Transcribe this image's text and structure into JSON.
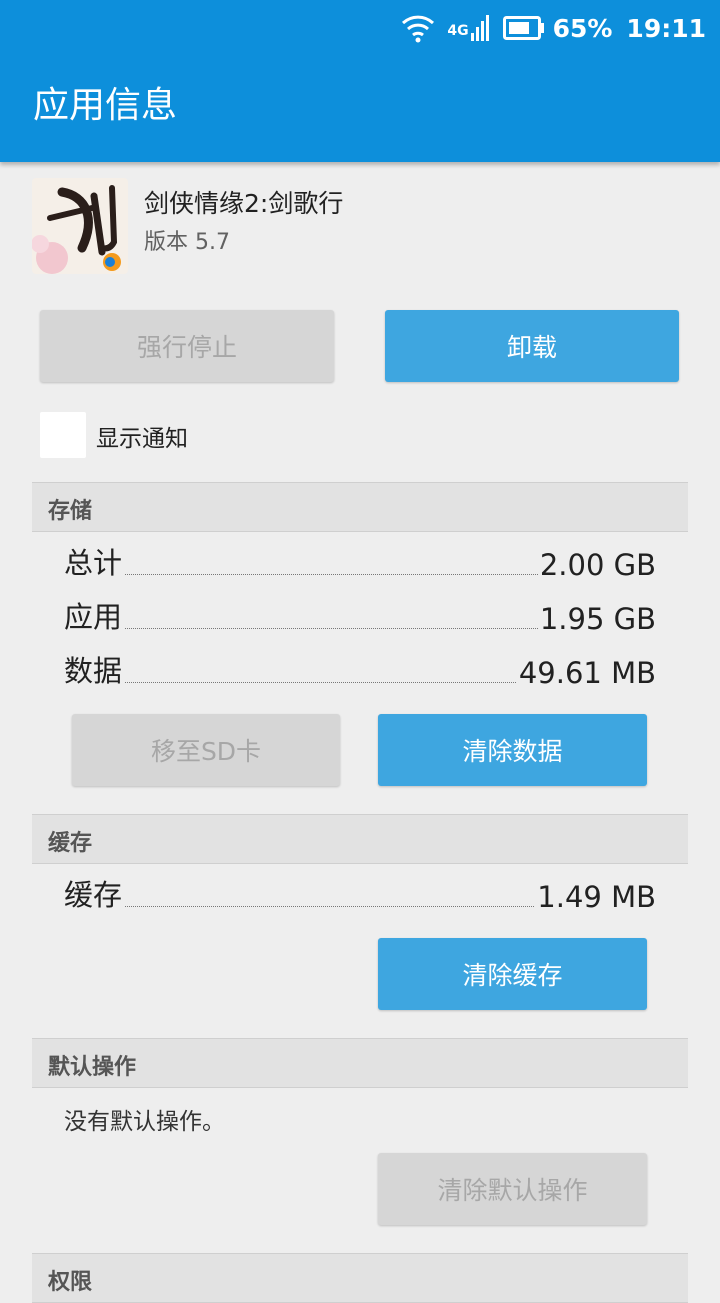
{
  "status_bar": {
    "network": "4G",
    "battery_percent": "65%",
    "time": "19:11"
  },
  "header": {
    "title": "应用信息"
  },
  "app": {
    "name": "剑侠情缘2:剑歌行",
    "version": "版本 5.7",
    "icon": "app-icon-jian"
  },
  "actions": {
    "force_stop_label": "强行停止",
    "uninstall_label": "卸载"
  },
  "notification": {
    "label": "显示通知",
    "checked": false
  },
  "storage": {
    "header": "存储",
    "rows": [
      {
        "label": "总计",
        "value": "2.00 GB"
      },
      {
        "label": "应用",
        "value": "1.95 GB"
      },
      {
        "label": "数据",
        "value": "49.61 MB"
      }
    ],
    "move_sd_label": "移至SD卡",
    "clear_data_label": "清除数据"
  },
  "cache": {
    "header": "缓存",
    "rows": [
      {
        "label": "缓存",
        "value": "1.49 MB"
      }
    ],
    "clear_cache_label": "清除缓存"
  },
  "defaults": {
    "header": "默认操作",
    "text": "没有默认操作。",
    "clear_defaults_label": "清除默认操作"
  },
  "permissions": {
    "header": "权限"
  },
  "colors": {
    "app_bar": "#0d8fdb",
    "primary_button": "#3ea6e0",
    "disabled_button": "#d6d6d6"
  }
}
